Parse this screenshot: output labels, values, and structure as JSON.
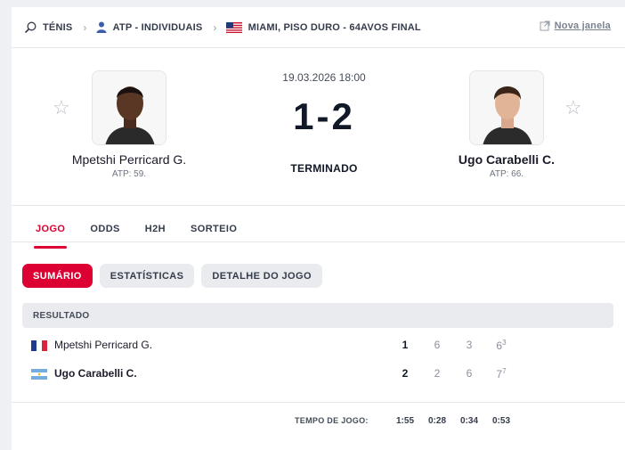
{
  "breadcrumb": {
    "sport": "TÉNIS",
    "category": "ATP - INDIVIDUAIS",
    "tournament": "MIAMI, PISO DURO - 64AVOS FINAL",
    "new_window": "Nova janela"
  },
  "match": {
    "datetime": "19.03.2026 18:00",
    "score": "1-2",
    "status": "TERMINADO"
  },
  "home": {
    "name": "Mpetshi Perricard G.",
    "rank": "ATP: 59.",
    "country_flag": "france"
  },
  "away": {
    "name": "Ugo Carabelli C.",
    "rank": "ATP: 66.",
    "country_flag": "argentina"
  },
  "tabs": [
    "JOGO",
    "ODDS",
    "H2H",
    "SORTEIO"
  ],
  "subtabs": [
    "SUMÁRIO",
    "ESTATÍSTICAS",
    "DETALHE DO JOGO"
  ],
  "result": {
    "header": "RESULTADO",
    "rows": [
      {
        "name": "Mpetshi Perricard G.",
        "sets": "1",
        "g1": "6",
        "g2": "3",
        "g3": "6",
        "g3_tb": "3",
        "bold": false
      },
      {
        "name": "Ugo Carabelli C.",
        "sets": "2",
        "g1": "2",
        "g2": "6",
        "g3": "7",
        "g3_tb": "7",
        "bold": true
      }
    ]
  },
  "time": {
    "label": "TEMPO DE JOGO:",
    "total": "1:55",
    "set1": "0:28",
    "set2": "0:34",
    "set3": "0:53"
  },
  "colors": {
    "accent": "#dc0033"
  }
}
